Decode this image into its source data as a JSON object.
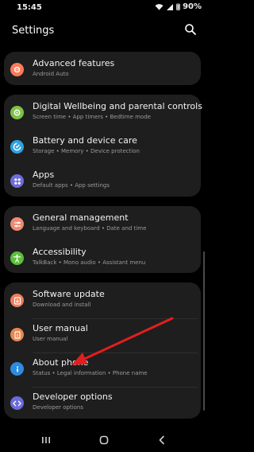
{
  "status_bar": {
    "time": "15:45",
    "battery": "90%"
  },
  "header": {
    "title": "Settings"
  },
  "settings": [
    {
      "title": "Advanced features",
      "subtitle": "Android Auto",
      "icon": "star-gear-icon",
      "color": "#ff7a5c"
    },
    {
      "title": "Digital Wellbeing and parental controls",
      "subtitle": "Screen time  •  App timers  •  Bedtime mode",
      "icon": "wellbeing-icon",
      "color": "#7ec246"
    },
    {
      "title": "Battery and device care",
      "subtitle": "Storage  •  Memory  •  Device protection",
      "icon": "device-care-icon",
      "color": "#2da3e0"
    },
    {
      "title": "Apps",
      "subtitle": "Default apps  •  App settings",
      "icon": "apps-icon",
      "color": "#6d6ddb"
    },
    {
      "title": "General management",
      "subtitle": "Language and keyboard  •  Date and time",
      "icon": "sliders-icon",
      "color": "#f08a72"
    },
    {
      "title": "Accessibility",
      "subtitle": "TalkBack  •  Mono audio  •  Assistant menu",
      "icon": "accessibility-icon",
      "color": "#5cbf3a"
    },
    {
      "title": "Software update",
      "subtitle": "Download and install",
      "icon": "software-update-icon",
      "color": "#f07d5c"
    },
    {
      "title": "User manual",
      "subtitle": "User manual",
      "icon": "user-manual-icon",
      "color": "#e8874f"
    },
    {
      "title": "About phone",
      "subtitle": "Status  •  Legal information  •  Phone name",
      "icon": "info-icon",
      "color": "#2d8be0"
    },
    {
      "title": "Developer options",
      "subtitle": "Developer options",
      "icon": "developer-icon",
      "color": "#6b6bd9"
    }
  ],
  "annotation": {
    "arrow_color": "#e31e1e"
  },
  "navigation": {
    "recents": "recents-icon",
    "home": "home-icon",
    "back": "back-icon"
  }
}
